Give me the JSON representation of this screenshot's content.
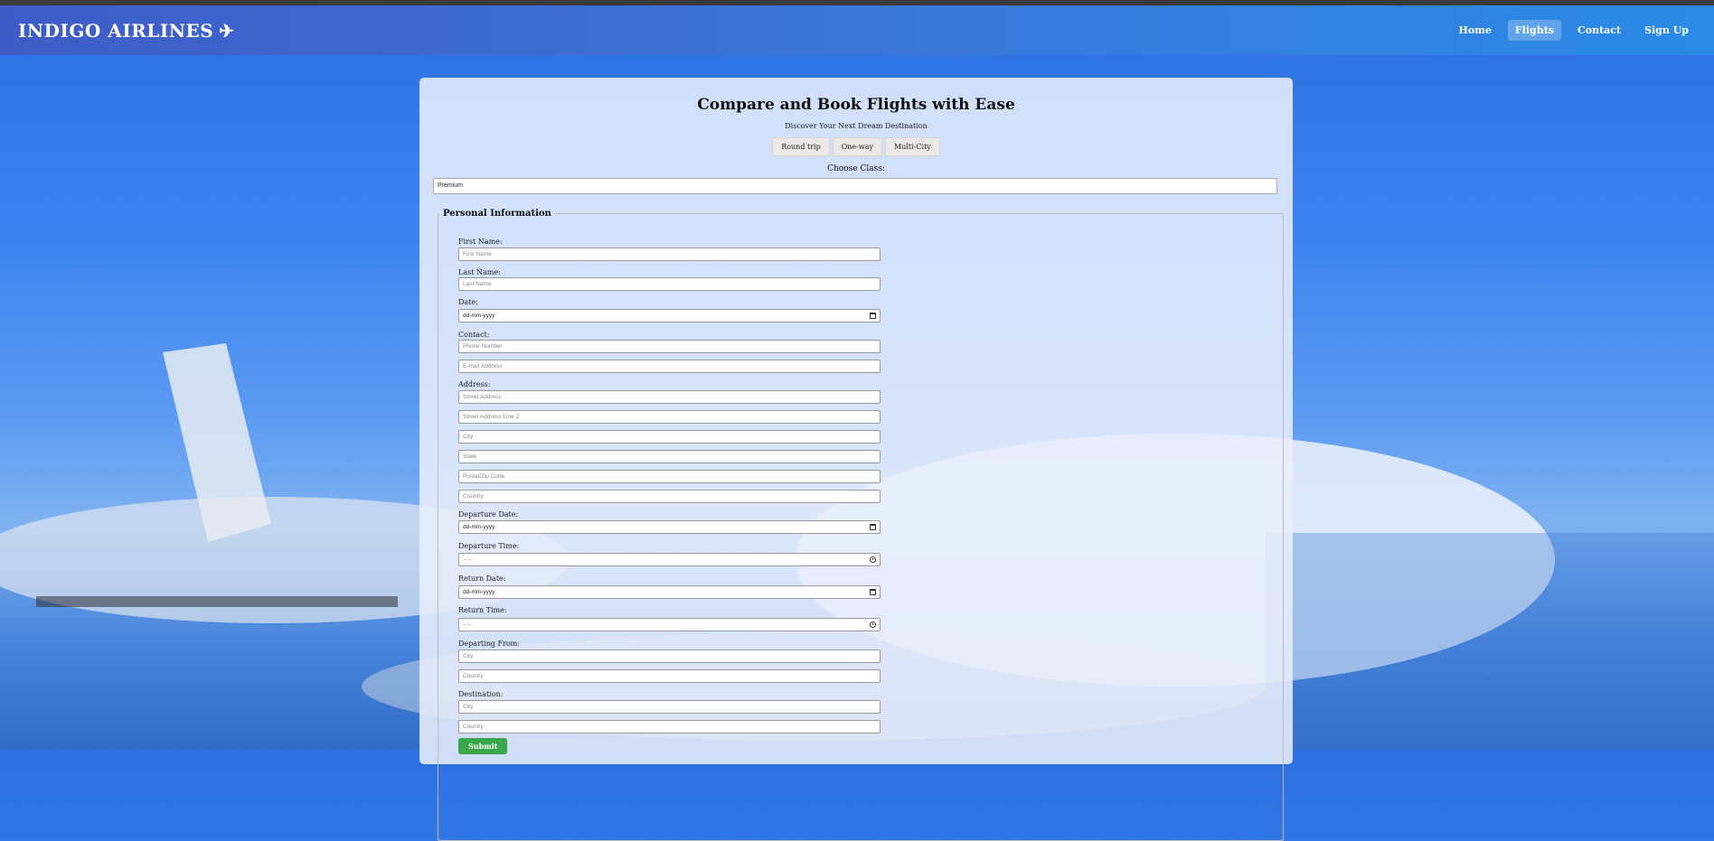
{
  "nav": {
    "brand": "INDIGO AIRLINES",
    "brand_icon": "airplane-icon",
    "links": [
      "Home",
      "Flights",
      "Contact",
      "Sign Up"
    ],
    "active": "Flights"
  },
  "hero": {
    "title": "Compare and Book Flights with Ease",
    "subtitle": "Discover Your Next Dream Destination",
    "trip_types": [
      "Round trip",
      "One-way",
      "Multi-City"
    ],
    "class_label": "Choose Class:",
    "class_value": "Premium"
  },
  "form": {
    "legend": "Personal Information",
    "first_name_label": "First Name:",
    "first_name_placeholder": "First Name",
    "last_name_label": "Last Name:",
    "last_name_placeholder": "Last Name",
    "date_label": "Date:",
    "date_placeholder": "dd-mm-yyyy",
    "contact_label": "Contact:",
    "phone_placeholder": "Phone Number",
    "email_placeholder": "E-mail Address",
    "address_label": "Address:",
    "street_placeholder": "Street Address",
    "street2_placeholder": "Street Address Line 2",
    "city_placeholder": "City",
    "state_placeholder": "State",
    "postal_placeholder": "Postal/Zip Code",
    "country_placeholder": "Country",
    "departure_date_label": "Departure Date:",
    "departure_time_label": "Departure Time:",
    "return_date_label": "Return Date:",
    "return_time_label": "Return Time:",
    "time_placeholder": "--:--",
    "departing_from_label": "Departing From:",
    "destination_label": "Destination:",
    "submit_label": "Submit"
  },
  "colors": {
    "nav_gradient_start": "#3f5cc6",
    "nav_gradient_end": "#2a8ae6",
    "submit": "#3aa84a"
  }
}
